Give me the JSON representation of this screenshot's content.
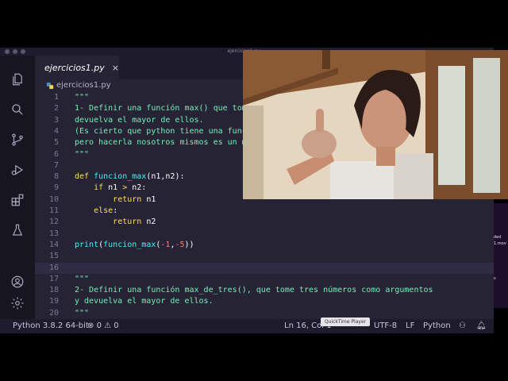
{
  "window": {
    "title": "ejercicios1.py —"
  },
  "tab": {
    "label": "ejercicios1.py",
    "close": "×",
    "icon": "python-icon"
  },
  "breadcrumb": {
    "file": "ejercicios1.py"
  },
  "colors": {
    "background": "#262335",
    "titlebar": "#1e1b2c",
    "activity_bar": "#171520",
    "comment": "#72f1b8",
    "keyword": "#fede5d",
    "function": "#36f9f6",
    "number": "#f97e72",
    "operator": "#fede5d",
    "text": "#ffffff"
  },
  "activity_bar": [
    "files-icon",
    "search-icon",
    "source-control-icon",
    "run-debug-icon",
    "extensions-icon",
    "testing-icon",
    "account-icon",
    "settings-gear-icon"
  ],
  "lines": [
    {
      "n": "1",
      "segments": [
        {
          "t": "\"\"\"",
          "c": "comment"
        }
      ]
    },
    {
      "n": "2",
      "segments": [
        {
          "t": "1- Definir una función max() que tome",
          "c": "comment"
        }
      ]
    },
    {
      "n": "3",
      "segments": [
        {
          "t": "devuelva el mayor de ellos.",
          "c": "comment"
        }
      ]
    },
    {
      "n": "4",
      "segments": [
        {
          "t": "(Es cierto que python tiene una funci",
          "c": "comment"
        }
      ]
    },
    {
      "n": "5",
      "segments": [
        {
          "t": "pero hacerla nosotros mismos es un mu",
          "c": "comment"
        }
      ]
    },
    {
      "n": "6",
      "segments": [
        {
          "t": "\"\"\"",
          "c": "comment"
        }
      ]
    },
    {
      "n": "7",
      "segments": []
    },
    {
      "n": "8",
      "segments": [
        {
          "t": "def ",
          "c": "keyword"
        },
        {
          "t": "funcion_max",
          "c": "function"
        },
        {
          "t": "(n1,n2):",
          "c": "text"
        }
      ]
    },
    {
      "n": "9",
      "segments": [
        {
          "t": "    ",
          "c": "text"
        },
        {
          "t": "if ",
          "c": "keyword"
        },
        {
          "t": "n1 ",
          "c": "text"
        },
        {
          "t": "> ",
          "c": "operator"
        },
        {
          "t": "n2:",
          "c": "text"
        }
      ]
    },
    {
      "n": "10",
      "segments": [
        {
          "t": "        ",
          "c": "text"
        },
        {
          "t": "return ",
          "c": "keyword"
        },
        {
          "t": "n1",
          "c": "text"
        }
      ]
    },
    {
      "n": "11",
      "segments": [
        {
          "t": "    ",
          "c": "text"
        },
        {
          "t": "else",
          "c": "keyword"
        },
        {
          "t": ":",
          "c": "text"
        }
      ]
    },
    {
      "n": "12",
      "segments": [
        {
          "t": "        ",
          "c": "text"
        },
        {
          "t": "return ",
          "c": "keyword"
        },
        {
          "t": "n2",
          "c": "text"
        }
      ]
    },
    {
      "n": "13",
      "segments": []
    },
    {
      "n": "14",
      "segments": [
        {
          "t": "print",
          "c": "function"
        },
        {
          "t": "(",
          "c": "text"
        },
        {
          "t": "funcion_max",
          "c": "function"
        },
        {
          "t": "(",
          "c": "text"
        },
        {
          "t": "-1",
          "c": "number"
        },
        {
          "t": ",",
          "c": "text"
        },
        {
          "t": "-5",
          "c": "number"
        },
        {
          "t": "))",
          "c": "text"
        }
      ]
    },
    {
      "n": "15",
      "segments": []
    },
    {
      "n": "16",
      "segments": [],
      "current": true
    },
    {
      "n": "17",
      "segments": [
        {
          "t": "\"\"\"",
          "c": "comment"
        }
      ]
    },
    {
      "n": "18",
      "segments": [
        {
          "t": "2- Definir una función max_de_tres(), que tome tres números como argumentos",
          "c": "comment"
        }
      ]
    },
    {
      "n": "19",
      "segments": [
        {
          "t": "y devuelva el mayor de ellos.",
          "c": "comment"
        }
      ]
    },
    {
      "n": "20",
      "segments": [
        {
          "t": "\"\"\"",
          "c": "comment"
        }
      ]
    }
  ],
  "status": {
    "interpreter": "Python 3.8.2 64-bit",
    "errors": "0",
    "warnings": "0",
    "cursor": "Ln 16, Col 1",
    "encoding": "UTF-8",
    "eol": "LF",
    "language": "Python"
  },
  "tooltip": "QuickTime Player",
  "side_panel": {
    "line1": "ded",
    "line2": "1.mov",
    "line3": "s"
  }
}
